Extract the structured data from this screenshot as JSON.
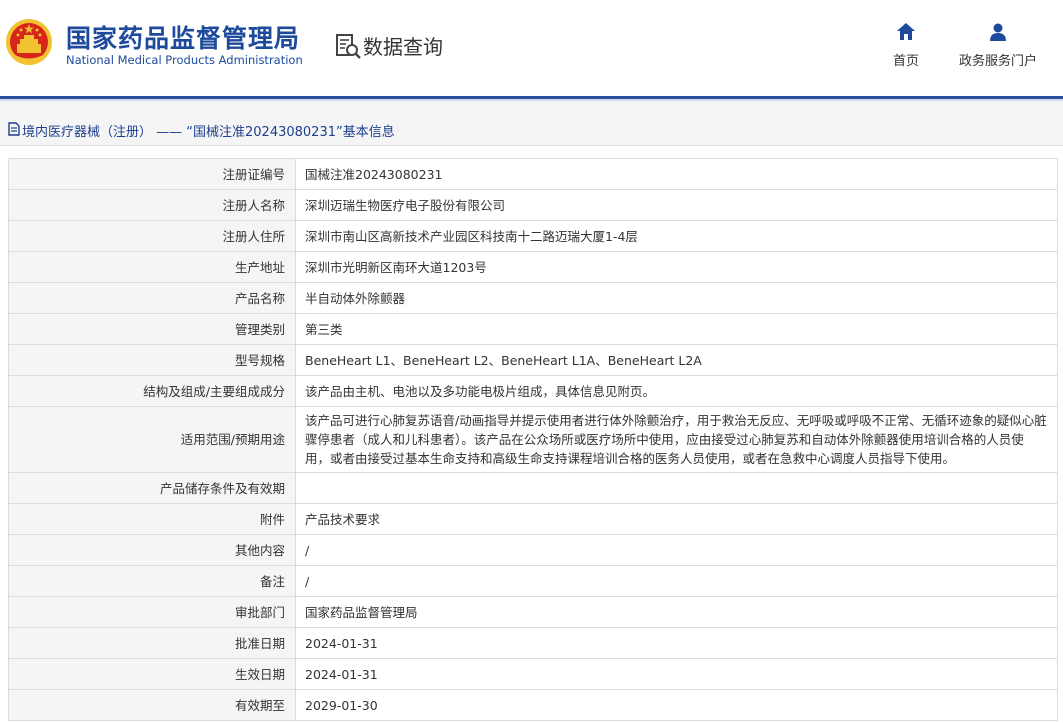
{
  "header": {
    "logo_cn": "国家药品监督管理局",
    "logo_en": "National Medical Products Administration",
    "query_label": "数据查询",
    "emblem_icon": "national-emblem-icon",
    "query_icon": "document-search-icon",
    "nav": [
      {
        "label": "首页",
        "icon": "home-icon"
      },
      {
        "label": "政务服务门户",
        "icon": "user-icon"
      }
    ]
  },
  "colors": {
    "brand_blue": "#1d4a9c",
    "stripe": "#2a4f9c",
    "label_bg": "#f5f5f5",
    "emblem_red": "#d6251b",
    "emblem_gold": "#f2c230"
  },
  "breadcrumb": {
    "text": "境内医疗器械（注册） —— “国械注准20243080231”基本信息",
    "icon": "document-icon"
  },
  "table": {
    "rows": [
      {
        "label": "注册证编号",
        "value": "国械注准20243080231"
      },
      {
        "label": "注册人名称",
        "value": "深圳迈瑞生物医疗电子股份有限公司"
      },
      {
        "label": "注册人住所",
        "value": "深圳市南山区高新技术产业园区科技南十二路迈瑞大厦1-4层"
      },
      {
        "label": "生产地址",
        "value": "深圳市光明新区南环大道1203号"
      },
      {
        "label": "产品名称",
        "value": "半自动体外除颤器"
      },
      {
        "label": "管理类别",
        "value": "第三类"
      },
      {
        "label": "型号规格",
        "value": "BeneHeart L1、BeneHeart L2、BeneHeart L1A、BeneHeart L2A"
      },
      {
        "label": "结构及组成/主要组成成分",
        "value": "该产品由主机、电池以及多功能电极片组成，具体信息见附页。"
      },
      {
        "label": "适用范围/预期用途",
        "value": "该产品可进行心肺复苏语音/动画指导并提示使用者进行体外除颤治疗，用于救治无反应、无呼吸或呼吸不正常、无循环迹象的疑似心脏骤停患者（成人和儿科患者）。该产品在公众场所或医疗场所中使用，应由接受过心肺复苏和自动体外除颤器使用培训合格的人员使用，或者由接受过基本生命支持和高级生命支持课程培训合格的医务人员使用，或者在急救中心调度人员指导下使用。"
      },
      {
        "label": "产品储存条件及有效期",
        "value": ""
      },
      {
        "label": "附件",
        "value": "产品技术要求"
      },
      {
        "label": "其他内容",
        "value": "/"
      },
      {
        "label": "备注",
        "value": "/"
      },
      {
        "label": "审批部门",
        "value": "国家药品监督管理局"
      },
      {
        "label": "批准日期",
        "value": "2024-01-31"
      },
      {
        "label": "生效日期",
        "value": "2024-01-31"
      },
      {
        "label": "有效期至",
        "value": "2029-01-30"
      }
    ]
  }
}
